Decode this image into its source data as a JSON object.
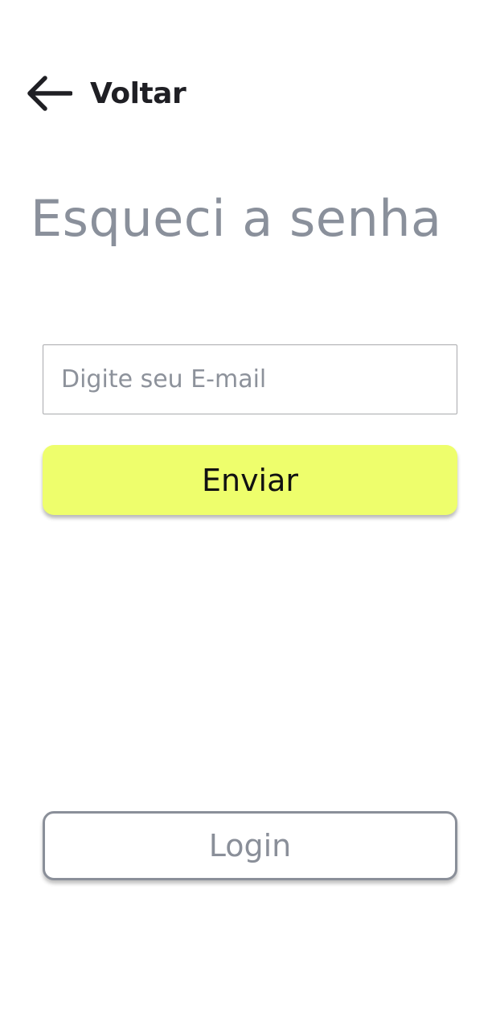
{
  "header": {
    "back_icon": "arrow-left-icon",
    "back_label": "Voltar"
  },
  "page": {
    "title": "Esqueci a senha"
  },
  "form": {
    "email_placeholder": "Digite seu E-mail",
    "email_value": "",
    "submit_label": "Enviar"
  },
  "footer": {
    "login_label": "Login"
  },
  "colors": {
    "accent": "#eefe6c",
    "title_gray": "#8a909b",
    "outline_gray": "#8a8f99",
    "text_dark": "#1f1f24"
  }
}
